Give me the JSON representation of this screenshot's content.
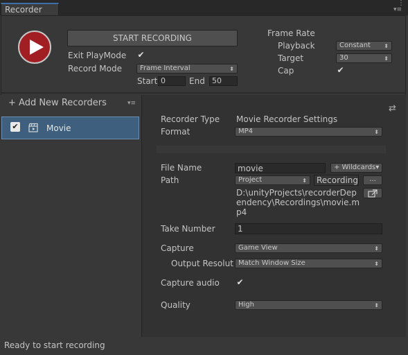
{
  "window": {
    "tab_title": "Recorder",
    "menu_dots": "⋮",
    "menu_lines": "▾≡"
  },
  "top": {
    "start_button": "START RECORDING",
    "exit_playmode_label": "Exit PlayMode",
    "exit_playmode_checked": true,
    "record_mode_label": "Record Mode",
    "record_mode_value": "Frame Interval",
    "start_label": "Start",
    "start_value": "0",
    "end_label": "End",
    "end_value": "50",
    "frame_rate_title": "Frame Rate",
    "playback_label": "Playback",
    "playback_value": "Constant",
    "target_label": "Target",
    "target_value": "30",
    "cap_label": "Cap",
    "cap_checked": true
  },
  "left": {
    "add_new_label": "+ Add New Recorders",
    "add_menu_icon": "▾≡",
    "recorders": [
      {
        "name": "Movie",
        "enabled": true,
        "icon": "clapperboard-icon"
      }
    ]
  },
  "right": {
    "settings_icon": "⇄",
    "recorder_type_label": "Recorder Type",
    "recorder_type_value": "Movie Recorder Settings",
    "format_label": "Format",
    "format_value": "MP4",
    "file_name_label": "File Name",
    "file_name_value": "movie",
    "wildcards_button": "+ Wildcards▾",
    "path_label": "Path",
    "path_location_value": "Project",
    "path_folder_value": "Recording",
    "browse_button": "...",
    "full_path_lines": [
      "D:\\unityProjects\\recorderDep",
      "endency\\Recordings\\movie.m",
      "p4"
    ],
    "take_number_label": "Take Number",
    "take_number_value": "1",
    "capture_label": "Capture",
    "capture_value": "Game View",
    "output_resolution_label": "Output Resolutio",
    "output_resolution_value": "Match Window Size",
    "capture_audio_label": "Capture audio",
    "capture_audio_checked": true,
    "quality_label": "Quality",
    "quality_value": "High"
  },
  "status": {
    "text": "Ready to start recording"
  },
  "icons": {
    "check": "✔",
    "dropdown_arrow": "⬍"
  },
  "colors": {
    "record_red": "#a11e22",
    "tab_accent": "#3d6fa8",
    "selected_row": "#3e5f7d"
  }
}
